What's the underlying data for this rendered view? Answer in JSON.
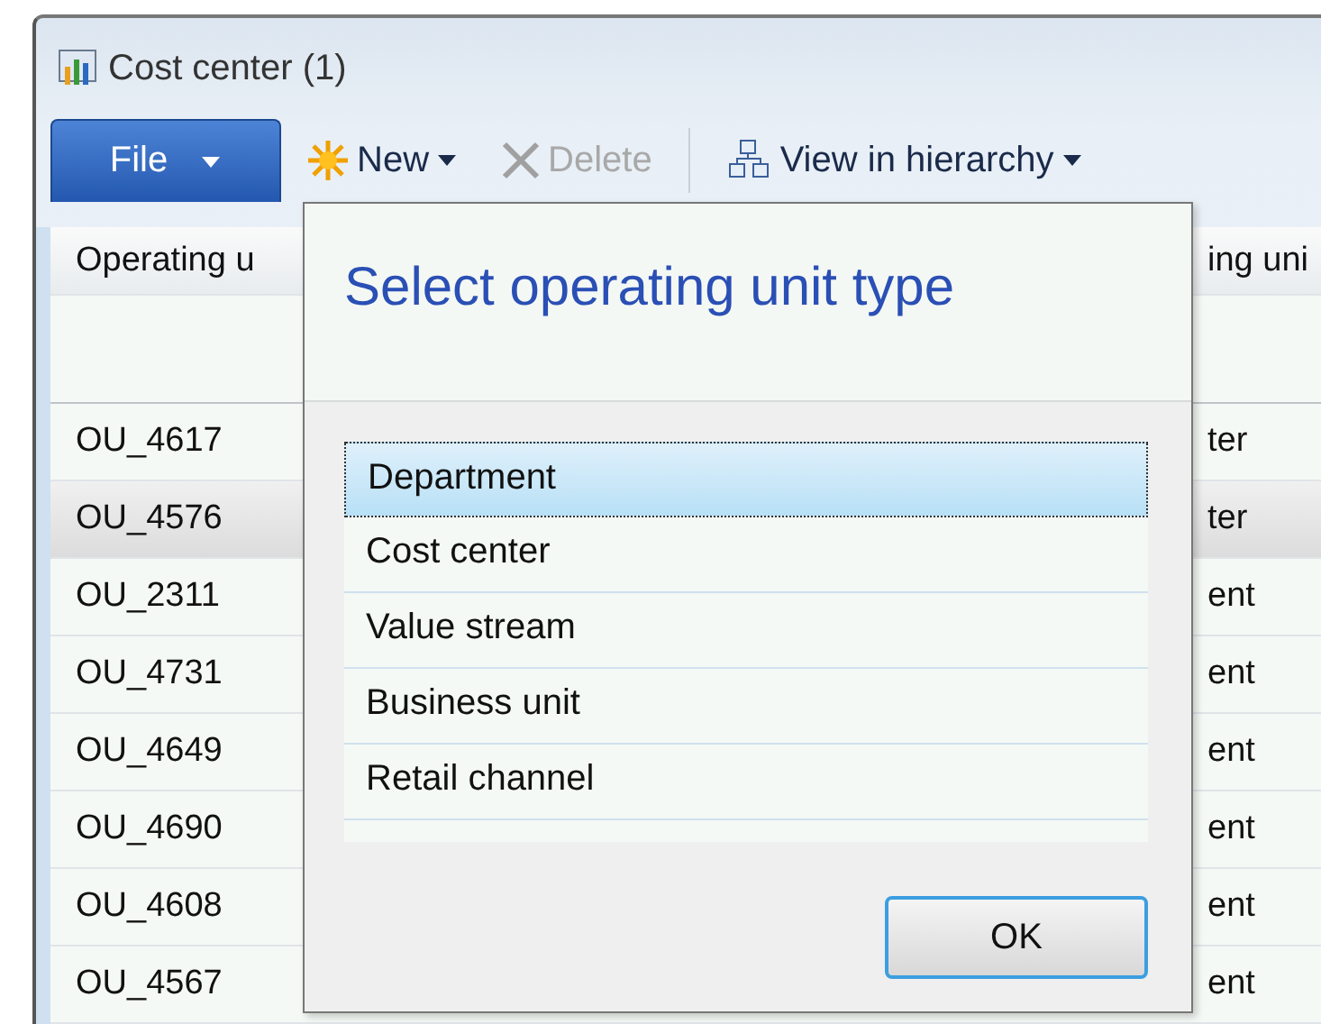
{
  "window": {
    "title": "Cost center (1)"
  },
  "toolbar": {
    "file_button": {
      "label": "File"
    },
    "items": [
      {
        "kind": "new",
        "label": "New",
        "disabled": false,
        "has_menu": true
      },
      {
        "kind": "delete",
        "label": "Delete",
        "disabled": true,
        "has_menu": false
      },
      {
        "kind": "hierarchy",
        "label": "View in hierarchy",
        "disabled": false,
        "has_menu": true
      }
    ]
  },
  "grid": {
    "columns": [
      "Operating u",
      "ing uni"
    ],
    "rows": [
      {
        "column_1": "OU_4617",
        "column_3": "ter",
        "selected": false
      },
      {
        "column_1": "OU_4576",
        "column_3": "ter",
        "selected": true
      },
      {
        "column_1": "OU_2311",
        "column_3": "ent",
        "selected": false
      },
      {
        "column_1": "OU_4731",
        "column_3": "ent",
        "selected": false
      },
      {
        "column_1": "OU_4649",
        "column_3": "ent",
        "selected": false
      },
      {
        "column_1": "OU_4690",
        "column_3": "ent",
        "selected": false
      },
      {
        "column_1": "OU_4608",
        "column_3": "ent",
        "selected": false
      },
      {
        "column_1": "OU_4567",
        "column_3": "ent",
        "selected": false
      }
    ]
  },
  "dialog": {
    "title": "Select operating unit type",
    "options": [
      {
        "label": "Department",
        "selected": true
      },
      {
        "label": "Cost center",
        "selected": false
      },
      {
        "label": "Value stream",
        "selected": false
      },
      {
        "label": "Business unit",
        "selected": false
      },
      {
        "label": "Retail channel",
        "selected": false
      }
    ],
    "ok_button": "OK"
  }
}
